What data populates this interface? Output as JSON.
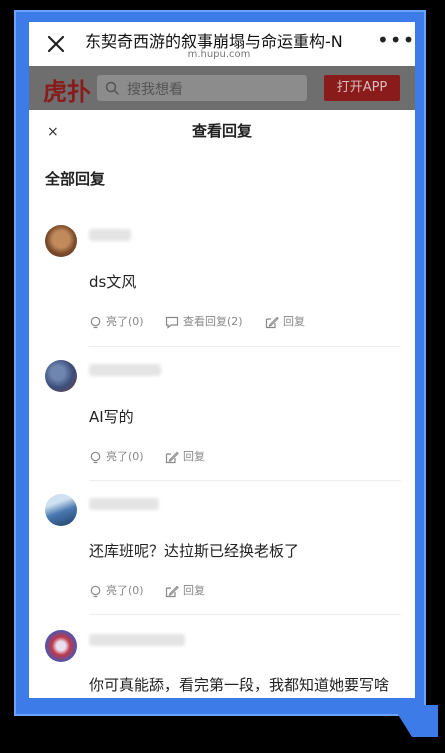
{
  "browser": {
    "title": "东契奇西游的叙事崩塌与命运重构-N",
    "domain": "m.hupu.com",
    "more": "•••"
  },
  "site": {
    "logo": "虎扑",
    "search_placeholder": "搜我想看",
    "open_app": "打开APP"
  },
  "sheet": {
    "close": "×",
    "title": "查看回复",
    "section_title": "全部回复"
  },
  "replies": [
    {
      "content": "ds文风",
      "like": "亮了(0)",
      "view_replies": "查看回复(2)",
      "reply": "回复",
      "avatar_color": "#8a5a3a"
    },
    {
      "content": "AI写的",
      "like": "亮了(0)",
      "reply": "回复",
      "avatar_color": "#3f5a8a"
    },
    {
      "content": "还库班呢？达拉斯已经换老板了",
      "like": "亮了(0)",
      "reply": "回复",
      "avatar_color": "#4a78b0"
    },
    {
      "content": "你可真能舔，看完第一段，我都知道她要写啥",
      "avatar_color": "#3a5ac0"
    }
  ],
  "colors": {
    "frame": "#3d7be8",
    "brand_red": "#8a1b1b"
  }
}
